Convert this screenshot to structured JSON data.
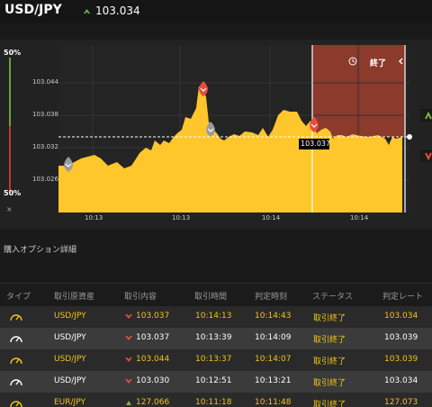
{
  "header": {
    "pair": "USD/JPY",
    "rate": "103.034",
    "rate_direction": "up",
    "up_color": "#7cb342"
  },
  "chart": {
    "pct_top": "50%",
    "pct_bottom": "50%",
    "close_label": "×",
    "expiry_label": "終了",
    "current_price_label": "103.037",
    "fill_color": "#ffc72c",
    "expiry_zone_color": "#8b3a2c",
    "chart_data": {
      "type": "area",
      "ylim": [
        103.022,
        103.052
      ],
      "yticks": [
        "103.044",
        "103.038",
        "103.032",
        "103.026"
      ],
      "xticks": [
        "10:13",
        "10:13",
        "10:14",
        "10:14"
      ],
      "current_price": 103.034
    }
  },
  "section_title": "購入オプション詳細",
  "table": {
    "headers": [
      "タイプ",
      "取引原資産",
      "取引内容",
      "取引時間",
      "判定時刻",
      "ステータス",
      "判定レート"
    ],
    "rows": [
      {
        "type_icon": "gauge-icon",
        "asset": "USD/JPY",
        "dir": "down",
        "price": "103.037",
        "time": "10:14:13",
        "judge": "10:14:43",
        "status": "取引終了",
        "rate": "103.034",
        "highlight": true
      },
      {
        "type_icon": "gauge-icon",
        "asset": "USD/JPY",
        "dir": "down",
        "price": "103.037",
        "time": "10:13:39",
        "judge": "10:14:09",
        "status": "取引終了",
        "rate": "103.039",
        "highlight": false
      },
      {
        "type_icon": "gauge-icon",
        "asset": "USD/JPY",
        "dir": "down",
        "price": "103.044",
        "time": "10:13:37",
        "judge": "10:14:07",
        "status": "取引終了",
        "rate": "103.039",
        "highlight": true
      },
      {
        "type_icon": "gauge-icon",
        "asset": "USD/JPY",
        "dir": "down",
        "price": "103.030",
        "time": "10:12:51",
        "judge": "10:13:21",
        "status": "取引終了",
        "rate": "103.034",
        "highlight": false
      },
      {
        "type_icon": "gauge-icon",
        "asset": "EUR/JPY",
        "dir": "up",
        "price": "127.066",
        "time": "10:11:18",
        "judge": "10:11:48",
        "status": "取引終了",
        "rate": "127.073",
        "highlight": true
      }
    ],
    "gold_color": "#f0c419",
    "red_color": "#e74c3c",
    "green_color": "#7cb342"
  }
}
